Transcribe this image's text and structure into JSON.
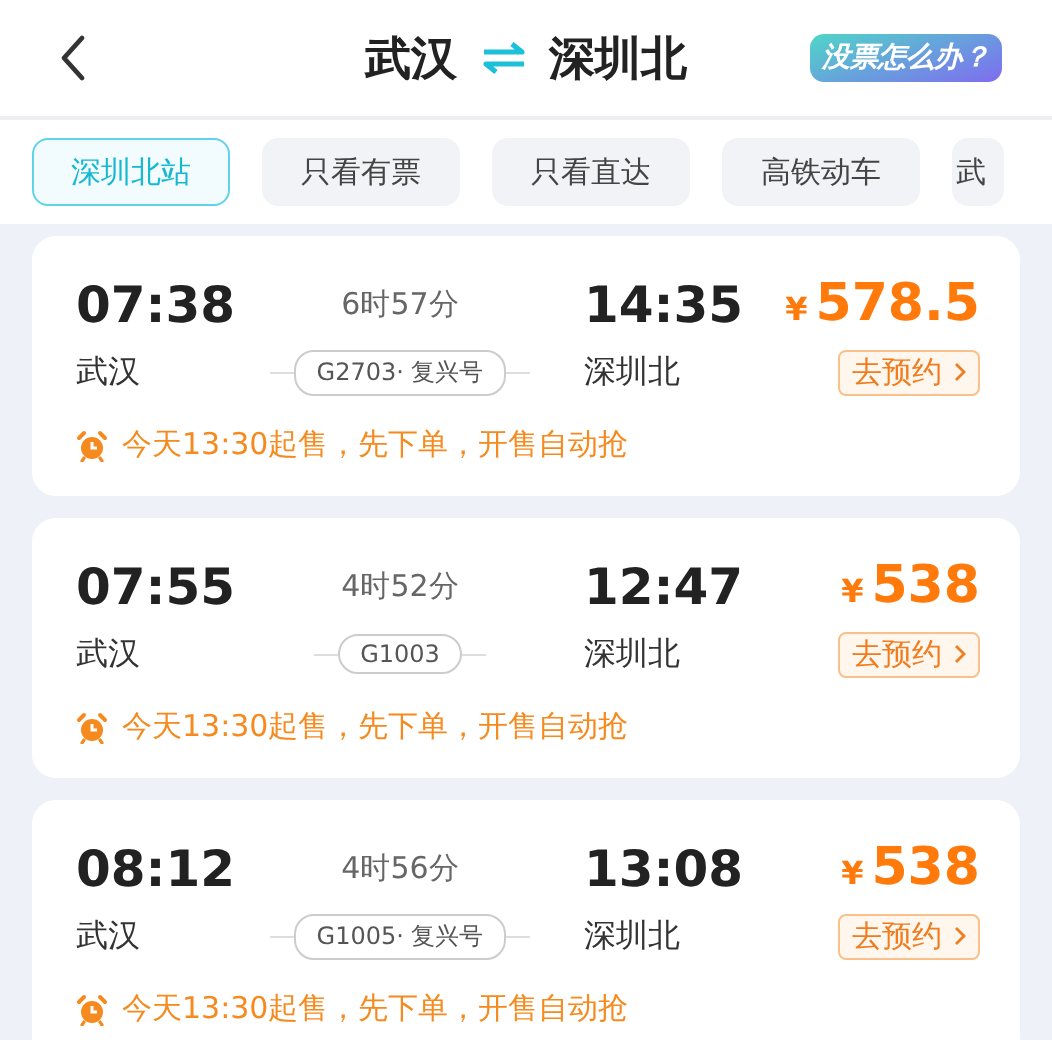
{
  "header": {
    "from": "武汉",
    "to": "深圳北",
    "help_button": "没票怎么办？"
  },
  "filters": [
    {
      "label": "深圳北站",
      "selected": true
    },
    {
      "label": "只看有票",
      "selected": false
    },
    {
      "label": "只看直达",
      "selected": false
    },
    {
      "label": "高铁动车",
      "selected": false
    },
    {
      "label": "武",
      "selected": false
    }
  ],
  "trains": [
    {
      "depart_time": "07:38",
      "duration": "6时57分",
      "arrive_time": "14:35",
      "currency": "¥",
      "price": "578.5",
      "depart_station": "武汉",
      "train": "G2703· 复兴号",
      "arrive_station": "深圳北",
      "action": "去预约",
      "notice": "今天13:30起售，先下单，开售自动抢"
    },
    {
      "depart_time": "07:55",
      "duration": "4时52分",
      "arrive_time": "12:47",
      "currency": "¥",
      "price": "538",
      "depart_station": "武汉",
      "train": "G1003",
      "arrive_station": "深圳北",
      "action": "去预约",
      "notice": "今天13:30起售，先下单，开售自动抢"
    },
    {
      "depart_time": "08:12",
      "duration": "4时56分",
      "arrive_time": "13:08",
      "currency": "¥",
      "price": "538",
      "depart_station": "武汉",
      "train": "G1005· 复兴号",
      "arrive_station": "深圳北",
      "action": "去预约",
      "notice": "今天13:30起售，先下单，开售自动抢"
    }
  ]
}
